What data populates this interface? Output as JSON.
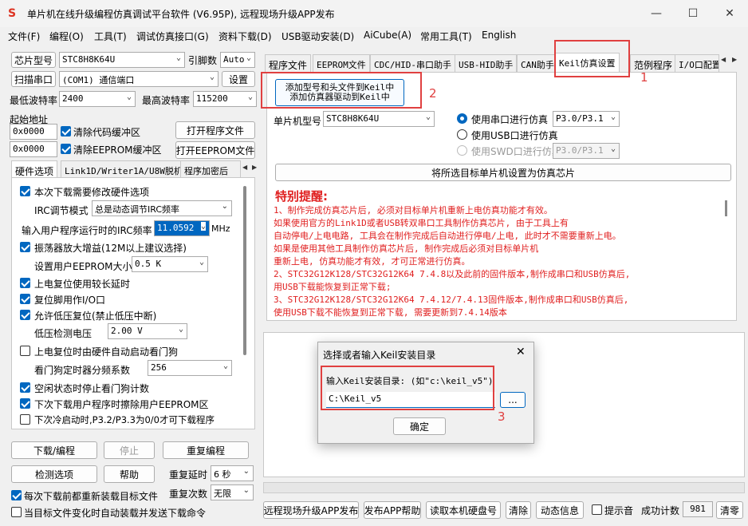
{
  "title": "单片机在线升级编程仿真调试平台软件 (V6.95P), 远程现场升级APP发布",
  "window": {
    "min": "—",
    "max": "☐",
    "close": "✕"
  },
  "menu": [
    "文件(F)",
    "编程(O)",
    "工具(T)",
    "调试仿真接口(G)",
    "资料下载(D)",
    "USB驱动安装(D)",
    "AiCube(A)",
    "常用工具(T)",
    "English"
  ],
  "left": {
    "chip_label": "芯片型号",
    "chip_value": "STC8H8K64U",
    "pin_label": "引脚数",
    "pin_value": "Auto",
    "scan_button": "扫描串口",
    "port_value": "(COM1) 通信端口",
    "settings_button": "设置",
    "min_baud_label": "最低波特率",
    "min_baud_value": "2400",
    "max_baud_label": "最高波特率",
    "max_baud_value": "115200",
    "start_addr_label": "起始地址",
    "code_addr": "0x0000",
    "clear_code": "清除代码缓冲区",
    "open_program": "打开程序文件",
    "eeprom_addr": "0x0000",
    "clear_eeprom": "清除EEPROM缓冲区",
    "open_eeprom": "打开EEPROM文件",
    "tabs": [
      "硬件选项",
      "Link1D/Writer1A/U8W脱机",
      "程序加密后"
    ],
    "hw": {
      "modify_hw": "本次下载需要修改硬件选项",
      "irc_mode_label": "IRC调节模式",
      "irc_mode_value": "总是动态调节IRC频率",
      "irc_freq_label": "输入用户程序运行时的IRC频率",
      "irc_freq_value": "11.0592",
      "irc_unit": "MHz",
      "osc_gain": "振荡器放大增益(12M以上建议选择)",
      "eeprom_size_label": "设置用户EEPROM大小",
      "eeprom_size_value": "0.5 K",
      "power_delay": "上电复位使用较长延时",
      "reset_io": "复位脚用作I/O口",
      "lvd_reset": "允许低压复位(禁止低压中断)",
      "lvd_label": "低压检测电压",
      "lvd_value": "2.00 V",
      "wdt_auto": "上电复位时由硬件自动启动看门狗",
      "wdt_div_label": "看门狗定时器分频系数",
      "wdt_div_value": "256",
      "idle_wdt": "空闲状态时停止看门狗计数",
      "erase_eeprom": "下次下载用户程序时擦除用户EEPROM区",
      "cold_boot": "下次冷启动时,P3.2/P3.3为0/0才可下载程序"
    },
    "download_button": "下载/编程",
    "stop_button": "停止",
    "reprogram_button": "重复编程",
    "detect_button": "检测选项",
    "help_button": "帮助",
    "repeat_delay_label": "重复延时",
    "repeat_delay_value": "6 秒",
    "repeat_count_label": "重复次数",
    "repeat_count_value": "无限",
    "reload_each": "每次下载前都重新装载目标文件",
    "auto_send": "当目标文件变化时自动装载并发送下载命令"
  },
  "right": {
    "tabs": [
      "程序文件",
      "EEPROM文件",
      "CDC/HID-串口助手",
      "USB-HID助手",
      "CAN助手",
      "Keil仿真设置",
      "范例程序",
      "I/O口配置"
    ],
    "add_keil_line1": "添加型号和头文件到Keil中",
    "add_keil_line2": "添加仿真器驱动到Keil中",
    "mcu_label": "单片机型号",
    "mcu_value": "STC8H8K64U",
    "uart_sim": "使用串口进行仿真",
    "uart_port": "P3.0/P3.1",
    "usb_sim": "使用USB口进行仿真",
    "swd_sim": "使用SWD口进行仿真",
    "swd_port": "P3.0/P3.1",
    "set_sim_chip": "将所选目标单片机设置为仿真芯片",
    "notice_title": "特别提醒:",
    "notice_lines": [
      "1、制作完成仿真芯片后, 必须对目标单片机重新上电仿真功能才有效。",
      "   如果使用官方的Link1D或者USB转双串口工具制作仿真芯片, 由于工具上有",
      "   自动停电/上电电路, 工具会在制作完成后自动进行停电/上电, 此时才不需要重新上电。",
      "   如果是使用其他工具制作仿真芯片后, 制作完成后必须对目标单片机",
      "   重新上电, 仿真功能才有效, 才可正常进行仿真。",
      "2、STC32G12K128/STC32G12K64  7.4.8以及此前的固件版本,制作成串口和USB仿真后,",
      "   用USB下载能恢复到正常下载;",
      "3、STC32G12K128/STC32G12K64  7.4.12/7.4.13固件版本,制作成串口和USB仿真后,",
      "   使用USB下载不能恢复到正常下载, 需要更新到7.4.14版本"
    ],
    "bottom_buttons": [
      "远程现场升级APP发布",
      "发布APP帮助",
      "读取本机硬盘号",
      "清除",
      "动态信息"
    ],
    "beep": "提示音",
    "success_label": "成功计数",
    "success_value": "981",
    "clear_count": "清零"
  },
  "dialog": {
    "title": "选择或者输入Keil安装目录",
    "close": "✕",
    "prompt": "输入Keil安装目录: (如\"c:\\keil_v5\")",
    "path": "C:\\Keil_v5",
    "browse": "...",
    "ok": "确定"
  },
  "markers": [
    "1",
    "2",
    "3"
  ],
  "colors": {
    "accent": "#0067c0",
    "annotation": "#e04040",
    "warning": "#e02020"
  },
  "icons": [
    "app-icon",
    "chevron-down-icon",
    "checkbox-icon",
    "radio-icon",
    "scroll-left-icon",
    "scroll-right-icon",
    "close-icon"
  ]
}
